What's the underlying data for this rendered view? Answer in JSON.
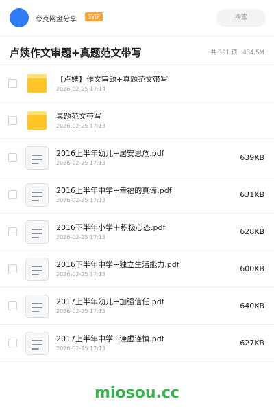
{
  "header": {
    "app_name": "夸克网盘分享",
    "badge": "SVIP",
    "search_placeholder": "搜索"
  },
  "folder": {
    "title": "卢姨作文审题+真题范文带写",
    "summary": "共 391 项 · 434.5M"
  },
  "files": [
    {
      "type": "folder",
      "name": "【卢姨】作文审题+真题范文带写",
      "date": "2026-02-25 17:14",
      "size": ""
    },
    {
      "type": "folder",
      "name": "真题范文带写",
      "date": "2026-02-25 17:13",
      "size": ""
    },
    {
      "type": "file",
      "name": "2016上半年幼儿+居安思危.pdf",
      "date": "2026-02-25 17:13",
      "size": "639KB"
    },
    {
      "type": "file",
      "name": "2016上半年中学+幸福的真谛.pdf",
      "date": "2026-02-25 17:13",
      "size": "631KB"
    },
    {
      "type": "file",
      "name": "2016下半年小学＋积极心态.pdf",
      "date": "2026-02-25 17:13",
      "size": "628KB"
    },
    {
      "type": "file",
      "name": "2016下半年中学+独立生活能力.pdf",
      "date": "2026-02-25 17:13",
      "size": "600KB"
    },
    {
      "type": "file",
      "name": "2017上半年幼儿+加强信任.pdf",
      "date": "2026-02-25 17:13",
      "size": "640KB"
    },
    {
      "type": "file",
      "name": "2017上半年中学+谦虚谨慎.pdf",
      "date": "2026-02-25 17:13",
      "size": "627KB"
    }
  ],
  "footer": {
    "watermark": "miosou.cc"
  },
  "colors": {
    "avatar": "#2f7cf6",
    "svip": "#f6a33a",
    "folder": "#ffc629",
    "watermark": "#37b24d"
  }
}
